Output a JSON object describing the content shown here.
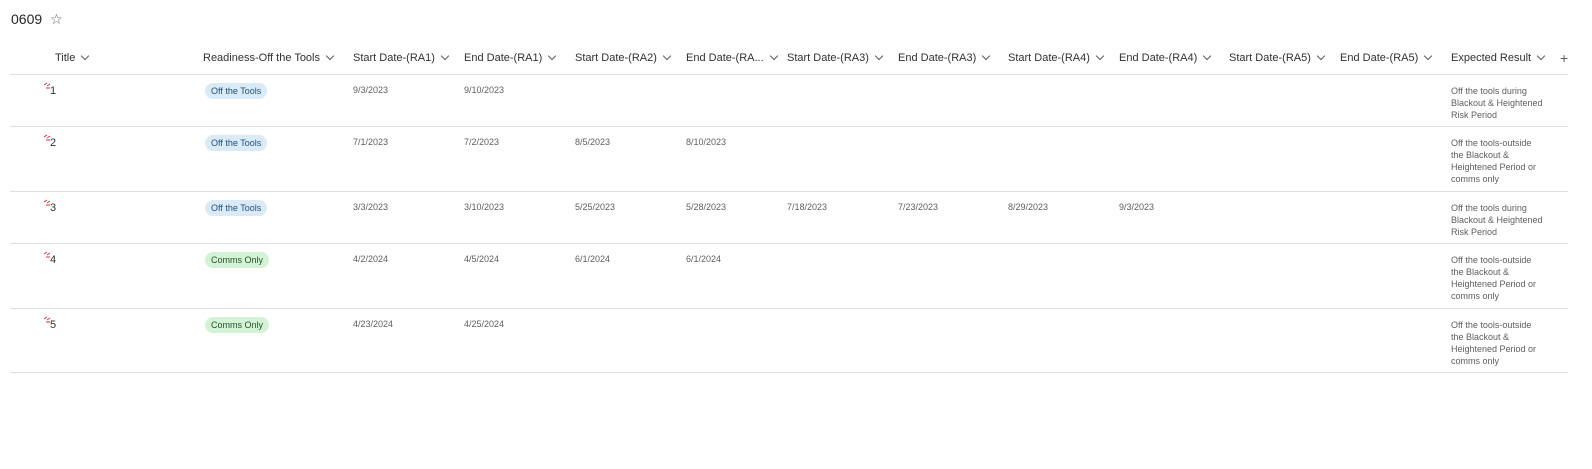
{
  "list": {
    "title": "0609",
    "favorite_icon": "star-icon"
  },
  "columns": [
    "Title",
    "Readiness-Off the Tools",
    "Start Date-(RA1)",
    "End Date-(RA1)",
    "Start Date-(RA2)",
    "End Date-(RA...",
    "Start Date-(RA3)",
    "End Date-(RA3)",
    "Start Date-(RA4)",
    "End Date-(RA4)",
    "Start Date-(RA5)",
    "End Date-(RA5)",
    "Expected Result"
  ],
  "add_column_label": "+",
  "rows": [
    {
      "title": "1",
      "readiness": "Off the Tools",
      "ra1_start": "9/3/2023",
      "ra1_end": "9/10/2023",
      "ra2_start": "",
      "ra2_end": "",
      "ra3_start": "",
      "ra3_end": "",
      "ra4_start": "",
      "ra4_end": "",
      "ra5_start": "",
      "ra5_end": "",
      "expected": "Off the tools during Blackout & Heightened Risk Period"
    },
    {
      "title": "2",
      "readiness": "Off the Tools",
      "ra1_start": "7/1/2023",
      "ra1_end": "7/2/2023",
      "ra2_start": "8/5/2023",
      "ra2_end": "8/10/2023",
      "ra3_start": "",
      "ra3_end": "",
      "ra4_start": "",
      "ra4_end": "",
      "ra5_start": "",
      "ra5_end": "",
      "expected": "Off the tools-outside the Blackout & Heightened Period or comms only"
    },
    {
      "title": "3",
      "readiness": "Off the Tools",
      "ra1_start": "3/3/2023",
      "ra1_end": "3/10/2023",
      "ra2_start": "5/25/2023",
      "ra2_end": "5/28/2023",
      "ra3_start": "7/18/2023",
      "ra3_end": "7/23/2023",
      "ra4_start": "8/29/2023",
      "ra4_end": "9/3/2023",
      "ra5_start": "",
      "ra5_end": "",
      "expected": "Off the tools during Blackout & Heightened Risk Period"
    },
    {
      "title": "4",
      "readiness": "Comms Only",
      "ra1_start": "4/2/2024",
      "ra1_end": "4/5/2024",
      "ra2_start": "6/1/2024",
      "ra2_end": "6/1/2024",
      "ra3_start": "",
      "ra3_end": "",
      "ra4_start": "",
      "ra4_end": "",
      "ra5_start": "",
      "ra5_end": "",
      "expected": "Off the tools-outside the Blackout & Heightened Period or comms only"
    },
    {
      "title": "5",
      "readiness": "Comms Only",
      "ra1_start": "4/23/2024",
      "ra1_end": "4/25/2024",
      "ra2_start": "",
      "ra2_end": "",
      "ra3_start": "",
      "ra3_end": "",
      "ra4_start": "",
      "ra4_end": "",
      "ra5_start": "",
      "ra5_end": "",
      "expected": "Off the tools-outside the Blackout & Heightened Period or comms only"
    }
  ],
  "pill_colors": {
    "Off the Tools": "#dbeaf7",
    "Comms Only": "#d3f2d6"
  },
  "new_item_icon": "new-item-sparkle-icon"
}
